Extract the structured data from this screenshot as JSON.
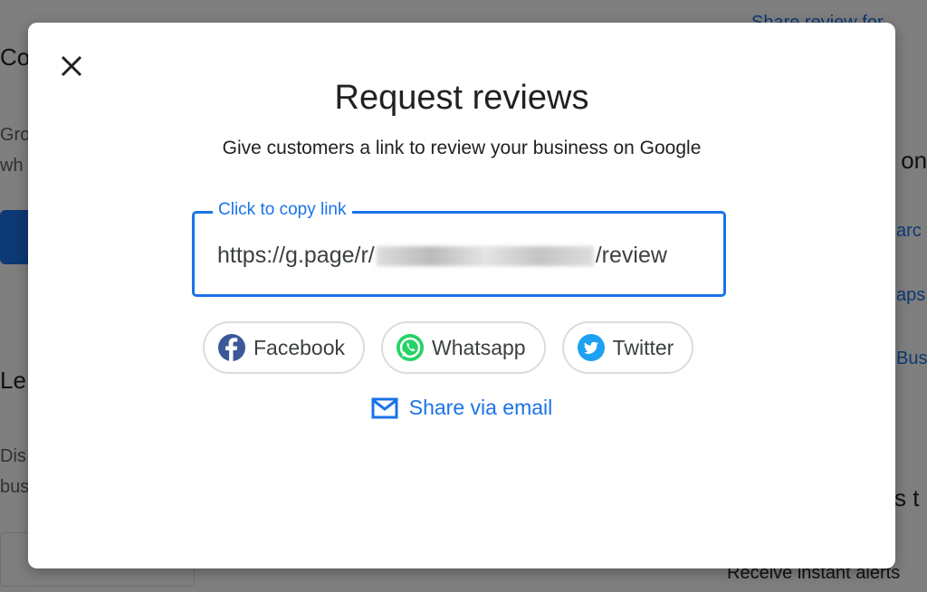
{
  "background": {
    "left_fragments": [
      "Co",
      "Gro",
      "wh",
      "Le",
      "Dis",
      "bus"
    ],
    "right_fragments": [
      "Share review for",
      "s on",
      "arc",
      "aps",
      "Bus",
      "ss t",
      "Receive instant alerts"
    ]
  },
  "modal": {
    "close_icon": "close-icon",
    "title": "Request reviews",
    "subtitle": "Give customers a link to review your business on Google",
    "link_field": {
      "label": "Click to copy link",
      "value_prefix": "https://g.page/r/",
      "value_suffix": "/review"
    },
    "share_buttons": [
      {
        "label": "Facebook",
        "icon": "facebook-icon",
        "color": "#3b5998"
      },
      {
        "label": "Whatsapp",
        "icon": "whatsapp-icon",
        "color": "#25d366"
      },
      {
        "label": "Twitter",
        "icon": "twitter-icon",
        "color": "#1da1f2"
      }
    ],
    "email_link": {
      "label": "Share via email",
      "icon": "mail-icon"
    }
  },
  "colors": {
    "accent": "#1a73e8"
  }
}
